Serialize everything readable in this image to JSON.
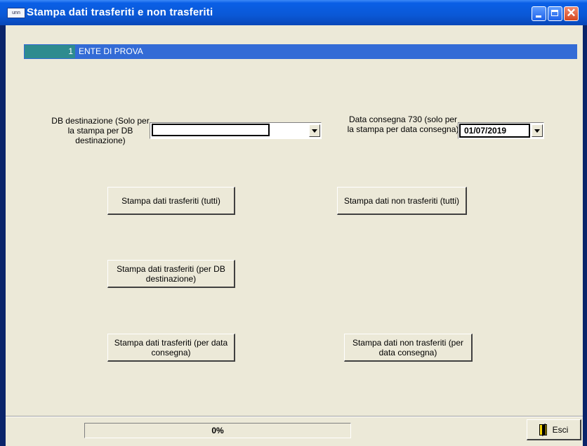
{
  "window": {
    "title": "Stampa dati trasferiti e non trasferiti",
    "app_icon_text": "unn"
  },
  "ente": {
    "code": "1",
    "name": "ENTE DI PROVA"
  },
  "db_destinazione": {
    "label": "DB destinazione (Solo per la stampa per DB destinazione)",
    "value": ""
  },
  "data_consegna": {
    "label": "Data consegna 730 (solo per la stampa per data consegna)",
    "value": "01/07/2019"
  },
  "buttons": {
    "trasferiti_tutti": "Stampa dati trasferiti (tutti)",
    "non_trasferiti_tutti": "Stampa dati non trasferiti (tutti)",
    "trasferiti_db": "Stampa dati trasferiti (per DB destinazione)",
    "trasferiti_data": "Stampa dati trasferiti (per data consegna)",
    "non_trasferiti_data": "Stampa dati non trasferiti (per data consegna)"
  },
  "status": {
    "progress_text": "0%",
    "progress_value": 0
  },
  "esci_label": "Esci",
  "colors": {
    "titlebar": "#0a58d6",
    "ente_bar": "#336bd6",
    "ente_code_bg": "#2e8b8f",
    "dialog_bg": "#ece9d8"
  },
  "icons": {
    "app": "app-icon",
    "minimize": "minimize-icon",
    "maximize": "maximize-icon",
    "close": "close-icon",
    "dropdown": "chevron-down-icon",
    "exit": "exit-door-icon"
  }
}
